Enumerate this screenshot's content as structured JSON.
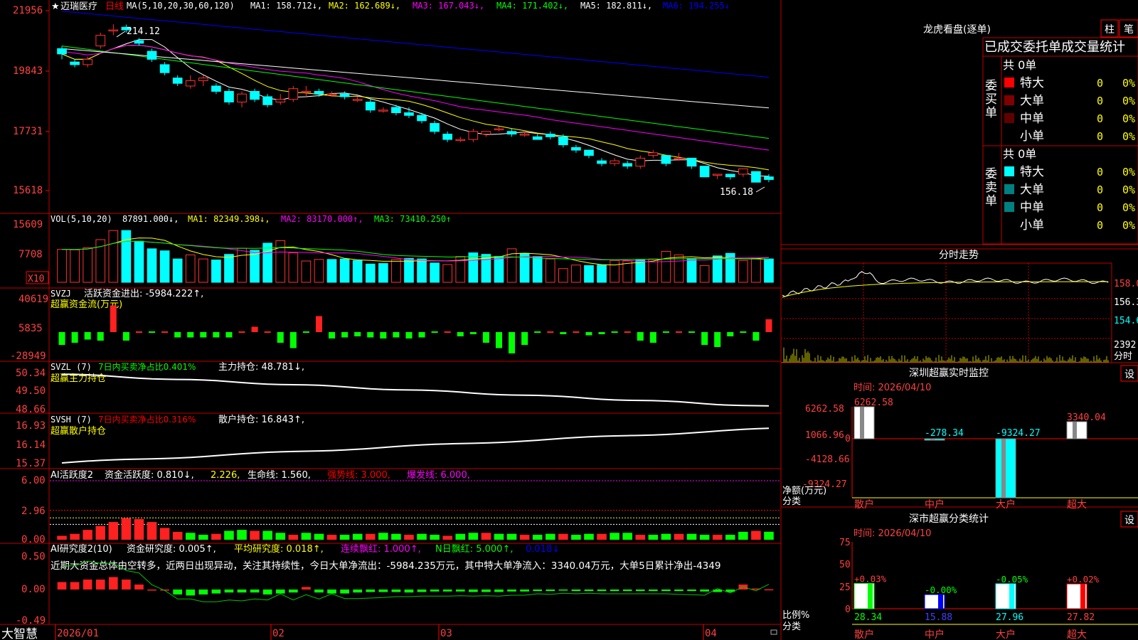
{
  "header": {
    "star": "★",
    "stock_name": "迈瑞医疗",
    "period": "日线",
    "ma_label": "MA(5,10,20,30,60,120)",
    "ma_items": [
      {
        "label": "MA1: 158.712↓,",
        "color": "#ffffff"
      },
      {
        "label": "MA2: 162.689↓,",
        "color": "#ffff00"
      },
      {
        "label": "MA3: 167.043↓,",
        "color": "#ff00ff"
      },
      {
        "label": "MA4: 171.402↓,",
        "color": "#00ff00"
      },
      {
        "label": "MA5: 182.811↓,",
        "color": "#ffffff"
      },
      {
        "label": "MA6: 194.255↓",
        "color": "#0000ff"
      }
    ]
  },
  "price_panel": {
    "axis_labels": [
      "21956",
      "19843",
      "17731",
      "15618"
    ],
    "high_label": "214.12",
    "low_label": "156.18"
  },
  "volume_panel": {
    "title": "VOL(5,10,20)",
    "value": "87891.000↓,",
    "ma1": "MA1: 82349.398↓,",
    "ma2": "MA2: 83170.000↑,",
    "ma3": "MA3: 73410.250↑",
    "axis_labels": [
      "15609",
      "7708"
    ],
    "unit": "X10"
  },
  "svzj_panel": {
    "title": "SVZJ",
    "text1": "活跃资金进出: -5984.222↑,",
    "text2": "超赢资金流(万元)",
    "axis_labels": [
      "40619",
      "5835",
      "-28949"
    ]
  },
  "svzl_panel": {
    "title": "SVZL (7)",
    "text1": "7日内买卖净占比0.401%",
    "text2": "主力持仓: 48.781↓,",
    "text3": "超赢主力持仓",
    "axis_labels": [
      "50.34",
      "49.50",
      "48.66"
    ]
  },
  "svsh_panel": {
    "title": "SVSH (7)",
    "text1": "7日内买卖净占比0.316%",
    "text2": "散户持仓: 16.843↑,",
    "text3": "超赢散户持仓",
    "axis_labels": [
      "16.93",
      "16.14",
      "15.37"
    ]
  },
  "ai1_panel": {
    "title": "AI活跃度2",
    "text1": "资金活跃度: 0.810↓,",
    "text2": "2.226,",
    "text3": "生命线: 1.560,",
    "text4": "强势线: 3.000,",
    "text5": "爆发线: 6.000,",
    "axis_labels": [
      "6.00",
      "2.96",
      "0.00"
    ]
  },
  "ai2_panel": {
    "title": "AI研究度2(10)",
    "text1": "资金研究度: 0.005↑,",
    "text2": "平均研究度: 0.018↑,",
    "text3": "连续飘红: 1.000↑,",
    "text4": "N日飘红: 5.000↑,",
    "text5": "0.018↓",
    "commentary": "近期大资金总体由空转多，近两日出现异动，关注其持续性，今日大单净流出：-5984.235万元，其中特大单净流入：3340.04万元，大单5日累计净出-4349",
    "axis_labels": [
      "0.50",
      "0.00",
      "-0.49"
    ]
  },
  "x_axis": {
    "brand": "大智慧",
    "months": [
      "2026/01",
      "02",
      "03",
      "04"
    ]
  },
  "right": {
    "lhb_title": "龙虎看盘(逐单)",
    "btn_zhu": "柱",
    "btn_bi": "笔",
    "order_title": "已成交委托单成交量统计",
    "buy_label": "委买单",
    "sell_label": "委卖单",
    "buy_total": "共 0单",
    "sell_total": "共 0单",
    "buy_rows": [
      {
        "name": "特大",
        "count": "0",
        "pct": "0%",
        "color": "#ff0000"
      },
      {
        "name": "大单",
        "count": "0",
        "pct": "0%",
        "color": "#800000"
      },
      {
        "name": "中单",
        "count": "0",
        "pct": "0%",
        "color": "#600000"
      },
      {
        "name": "小单",
        "count": "0",
        "pct": "0%",
        "color": "#000000"
      }
    ],
    "sell_rows": [
      {
        "name": "特大",
        "count": "0",
        "pct": "0%",
        "color": "#00ffff"
      },
      {
        "name": "大单",
        "count": "0",
        "pct": "0%",
        "color": "#008080"
      },
      {
        "name": "中单",
        "count": "0",
        "pct": "0%",
        "color": "#008080"
      },
      {
        "name": "小单",
        "count": "0",
        "pct": "0%",
        "color": "#000000"
      }
    ],
    "intraday_title": "分时走势",
    "intraday_labels": [
      "158.0",
      "156.3",
      "154.6",
      "2392",
      "分时"
    ],
    "sz_title": "深圳超赢实时监控",
    "sz_time": "时间: 2026/04/10",
    "sz_axis": [
      "6262.58",
      "1066.96",
      "0",
      "-4128.66",
      "-9324.27"
    ],
    "sz_bars": [
      {
        "cat": "散户",
        "value": 6262.58,
        "label": "6262.58"
      },
      {
        "cat": "中户",
        "value": -278.34,
        "label": "-278.34"
      },
      {
        "cat": "大户",
        "value": -9324.27,
        "label": "-9324.27"
      },
      {
        "cat": "超大",
        "value": 3340.04,
        "label": "3340.04"
      }
    ],
    "sz_ylabel1": "净额(万元)",
    "sz_ylabel2": "分类",
    "settings": "设",
    "cls_title": "深市超赢分类统计",
    "cls_time": "时间: 2026/04/10",
    "cls_axis": [
      "75",
      "50",
      "25",
      "0"
    ],
    "cls_bars": [
      {
        "cat": "散户",
        "value": 28.34,
        "change": "+0.03%",
        "color": "#00ff00"
      },
      {
        "cat": "中户",
        "value": 15.88,
        "change": "-0.00%",
        "color": "#0000ff"
      },
      {
        "cat": "大户",
        "value": 27.96,
        "change": "-0.05%",
        "color": "#00ffff"
      },
      {
        "cat": "超大",
        "value": 27.82,
        "change": "+0.02%",
        "color": "#ff0000"
      }
    ],
    "cls_ylabel1": "比例%",
    "cls_ylabel2": "分类"
  },
  "chart_data": {
    "type": "candlestick",
    "title": "迈瑞医疗 日线",
    "x_start": "2026-01-05",
    "x_end": "2026-04-10",
    "price_ylim": [
      150,
      220
    ],
    "candles": [
      [
        205,
        203,
        206,
        201
      ],
      [
        200,
        199,
        201,
        198
      ],
      [
        199,
        201,
        202,
        198
      ],
      [
        206,
        210,
        211,
        205
      ],
      [
        212,
        212,
        214.12,
        210
      ],
      [
        213,
        212,
        214,
        211
      ],
      [
        208,
        207,
        209,
        206
      ],
      [
        204,
        201,
        205,
        200
      ],
      [
        199,
        196,
        200,
        195
      ],
      [
        194,
        192,
        195,
        191
      ],
      [
        191,
        193,
        195,
        190
      ],
      [
        193,
        194,
        195,
        191
      ],
      [
        191,
        189,
        192,
        188
      ],
      [
        189,
        185,
        190,
        184
      ],
      [
        185,
        188,
        189,
        183
      ],
      [
        189,
        186,
        190,
        185
      ],
      [
        187,
        184,
        188,
        183
      ],
      [
        185,
        186,
        188,
        184
      ],
      [
        186,
        190,
        191,
        185
      ],
      [
        189,
        189,
        191,
        187
      ],
      [
        189,
        188,
        190,
        187
      ],
      [
        188,
        188,
        189,
        187
      ],
      [
        188,
        187,
        189,
        186
      ],
      [
        186,
        186,
        187,
        185
      ],
      [
        185,
        182,
        186,
        181
      ],
      [
        182,
        182,
        183,
        181
      ],
      [
        183,
        181,
        184,
        180
      ],
      [
        181,
        180,
        183,
        179
      ],
      [
        180,
        178,
        181,
        177
      ],
      [
        177,
        174,
        178,
        173
      ],
      [
        173,
        171,
        174,
        170
      ],
      [
        171,
        171,
        172,
        170
      ],
      [
        171,
        174,
        175,
        170
      ],
      [
        173,
        174,
        174,
        172
      ],
      [
        175,
        175,
        176,
        174
      ],
      [
        174,
        173,
        175,
        172
      ],
      [
        173,
        173,
        174,
        172
      ],
      [
        172,
        171,
        173,
        171
      ],
      [
        173,
        172,
        174,
        171
      ],
      [
        172,
        169,
        173,
        168
      ],
      [
        168,
        167,
        169,
        166
      ],
      [
        167,
        165,
        167,
        164
      ],
      [
        163,
        162,
        164,
        161
      ],
      [
        162,
        163,
        164,
        161
      ],
      [
        162,
        161,
        163,
        160
      ],
      [
        161,
        164,
        165,
        160
      ],
      [
        165,
        166,
        167,
        164
      ],
      [
        165,
        162,
        165,
        161
      ],
      [
        164,
        164,
        166,
        163
      ],
      [
        164,
        161,
        164,
        160
      ],
      [
        161,
        157,
        161,
        157
      ],
      [
        158,
        158,
        158,
        156.18
      ],
      [
        158,
        157,
        158,
        156
      ],
      [
        158,
        160,
        160,
        157
      ],
      [
        159,
        155,
        159,
        155
      ],
      [
        157,
        156,
        158,
        155
      ]
    ],
    "volume": [
      [
        6.5,
        1
      ],
      [
        6.4,
        1
      ],
      [
        6.8,
        1
      ],
      [
        8.4,
        1
      ],
      [
        10.2,
        1
      ],
      [
        10.2,
        0
      ],
      [
        8.1,
        0
      ],
      [
        6.6,
        0
      ],
      [
        6.2,
        0
      ],
      [
        4.6,
        0
      ],
      [
        5.4,
        1
      ],
      [
        4.6,
        1
      ],
      [
        4.4,
        0
      ],
      [
        5.5,
        0
      ],
      [
        6.7,
        1
      ],
      [
        6.3,
        0
      ],
      [
        7.7,
        0
      ],
      [
        8.2,
        1
      ],
      [
        5.8,
        1
      ],
      [
        4.2,
        1
      ],
      [
        4.5,
        1
      ],
      [
        4.5,
        0
      ],
      [
        4.6,
        0
      ],
      [
        4.3,
        0
      ],
      [
        3.6,
        0
      ],
      [
        3.7,
        0
      ],
      [
        4.5,
        1
      ],
      [
        4.7,
        0
      ],
      [
        4.6,
        0
      ],
      [
        3.8,
        0
      ],
      [
        3.5,
        1
      ],
      [
        5.1,
        1
      ],
      [
        5.8,
        0
      ],
      [
        5.5,
        0
      ],
      [
        5.1,
        0
      ],
      [
        6.6,
        1
      ],
      [
        5.7,
        0
      ],
      [
        5.1,
        0
      ],
      [
        4.6,
        1
      ],
      [
        2.7,
        1
      ],
      [
        3.4,
        1
      ],
      [
        3.3,
        0
      ],
      [
        3.4,
        0
      ],
      [
        4.3,
        1
      ],
      [
        4.2,
        1
      ],
      [
        4.4,
        0
      ],
      [
        4.6,
        1
      ],
      [
        6.1,
        1
      ],
      [
        5.4,
        1
      ],
      [
        4.7,
        0
      ],
      [
        3.3,
        1
      ],
      [
        5.2,
        0
      ],
      [
        5.7,
        0
      ],
      [
        4.3,
        1
      ],
      [
        4.7,
        1
      ],
      [
        4.6,
        0
      ]
    ],
    "svzj": [
      -12,
      -10,
      -7,
      -8,
      25,
      -8,
      0,
      0,
      0,
      -5,
      -5,
      -5,
      -5,
      -5,
      0,
      5,
      0,
      -10,
      -15,
      0,
      15,
      -6,
      -5,
      -4,
      -5,
      -6,
      -5,
      -6,
      -5,
      0,
      0,
      -4,
      -2,
      -10,
      -15,
      -20,
      -12,
      0,
      0,
      -2,
      0,
      -3,
      -2,
      0,
      0,
      -8,
      -10,
      0,
      0,
      0,
      -12,
      -14,
      -4,
      0,
      -8,
      12,
      -2,
      -22,
      -5
    ],
    "svzl_start": 50.3,
    "svzl_end": 48.78,
    "svsh_start": 15.4,
    "svsh_end": 16.84,
    "ai_active": [
      0.4,
      0.6,
      1.0,
      1.4,
      1.8,
      2.2,
      2.1,
      1.8,
      1.2,
      0.8,
      0.7,
      0.5,
      0.6,
      0.9,
      1.0,
      0.9,
      0.9,
      0.7,
      0.5,
      0.7,
      0.6,
      0.5,
      0.5,
      0.6,
      0.6,
      0.7,
      0.6,
      0.5,
      0.6,
      0.5,
      0.4,
      0.6,
      0.7,
      0.7,
      0.6,
      0.6,
      0.5,
      0.5,
      0.6,
      0.6,
      0.5,
      0.6,
      0.6,
      0.7,
      0.7,
      0.5,
      0.5,
      0.6,
      0.6,
      0.6,
      0.5,
      0.5,
      0.5,
      0.8,
      0.9,
      0.81
    ],
    "ai_research": [
      0.15,
      0.15,
      0.2,
      0.2,
      0.25,
      0.2,
      0.1,
      0,
      0,
      -0.1,
      -0.12,
      -0.1,
      -0.08,
      -0.06,
      -0.06,
      -0.06,
      -0.1,
      -0.08,
      -0.06,
      0.05,
      -0.06,
      -0.08,
      -0.08,
      -0.06,
      -0.05,
      -0.05,
      -0.05,
      -0.06,
      -0.05,
      -0.04,
      -0.04,
      -0.04,
      -0.05,
      -0.05,
      -0.05,
      -0.04,
      -0.04,
      -0.03,
      -0.03,
      -0.02,
      -0.03,
      -0.03,
      -0.03,
      -0.03,
      -0.03,
      -0.03,
      -0.03,
      -0.03,
      -0.03,
      -0.03,
      -0.04,
      -0.05,
      -0.05,
      0.1,
      0.02,
      0.005
    ]
  }
}
